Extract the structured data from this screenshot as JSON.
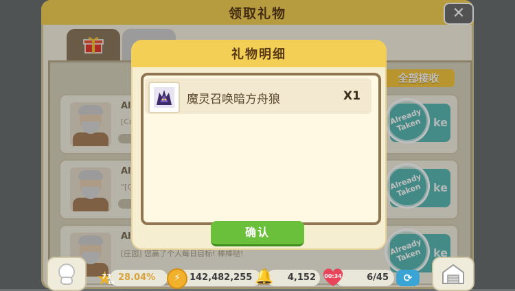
{
  "window": {
    "title": "领取礼物",
    "close_icon": "close-icon"
  },
  "tabs": [
    {
      "name": "gift",
      "icon": "gift-icon"
    },
    {
      "name": "other",
      "icon": "other-icon"
    }
  ],
  "list": {
    "receive_all_label": "全部接收",
    "rows": [
      {
        "sender": "Alf",
        "sub": "[Co",
        "stamp": "Already Taken",
        "take": "ke"
      },
      {
        "sender": "Alf",
        "sub": "\"[C",
        "stamp": "Already Taken",
        "take": "ke"
      },
      {
        "sender": "Alf",
        "sub": "[庄园] 您赢了个人每日目标! 棒棒哒!",
        "stamp": "Already Taken",
        "take": "ke"
      }
    ]
  },
  "modal": {
    "title": "礼物明细",
    "items": [
      {
        "name": "魔灵召唤暗方舟狼",
        "qty": "X1",
        "icon": "dark-wolf-icon"
      }
    ],
    "confirm_label": "确认"
  },
  "hud": {
    "level": "73",
    "level_tag": "LV",
    "exp_percent": "28.04%",
    "coins": "142,482,255",
    "gems": "4,152",
    "timer": "00:34",
    "energy": "6/45"
  },
  "colors": {
    "title_bar": "#f3cf55",
    "confirm_green": "#6abf3b",
    "take_teal": "#5bb8b4",
    "receive_all_yellow": "#f6c73f"
  }
}
